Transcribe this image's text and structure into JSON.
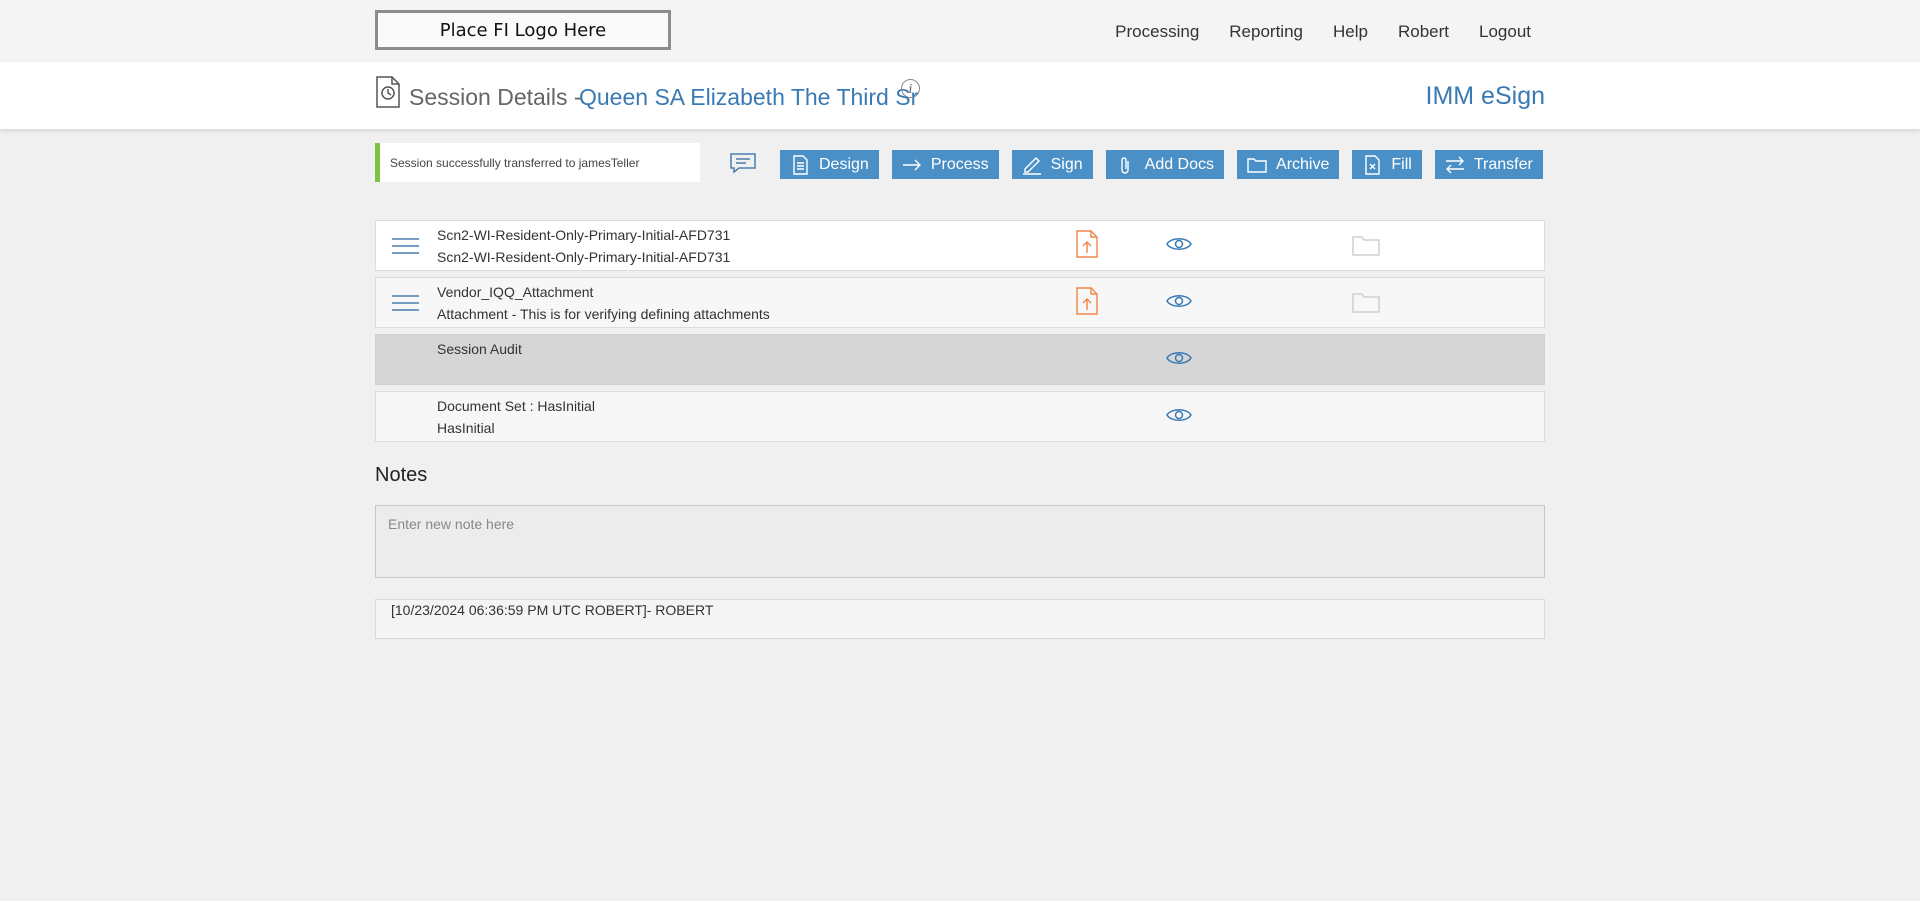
{
  "topbar": {
    "logo_text": "Place FI Logo Here",
    "nav": [
      "Processing",
      "Reporting",
      "Help",
      "Robert",
      "Logout"
    ]
  },
  "header": {
    "label": "Session Details -",
    "session_name": "Queen SA Elizabeth The Third Sr",
    "info_glyph": "i",
    "brand": "IMM eSign"
  },
  "toast": {
    "message": "Session successfully transferred to jamesTeller"
  },
  "actions": [
    {
      "label": "Design",
      "icon": "design-icon"
    },
    {
      "label": "Process",
      "icon": "arrow-right-icon"
    },
    {
      "label": "Sign",
      "icon": "pen-icon"
    },
    {
      "label": "Add Docs",
      "icon": "paperclip-icon"
    },
    {
      "label": "Archive",
      "icon": "folder-icon"
    },
    {
      "label": "Fill",
      "icon": "fill-doc-icon"
    },
    {
      "label": "Transfer",
      "icon": "swap-icon"
    }
  ],
  "documents": [
    {
      "line1": "Scn2-WI-Resident-Only-Primary-Initial-AFD731",
      "line2": "Scn2-WI-Resident-Only-Primary-Initial-AFD731",
      "menu": true,
      "upload": true,
      "folder": true,
      "state": "normal"
    },
    {
      "line1": "Vendor_IQQ_Attachment",
      "line2": "Attachment - This is for verifying defining attachments",
      "menu": true,
      "upload": true,
      "folder": true,
      "state": "alt"
    },
    {
      "line1": "Session Audit",
      "line2": "",
      "menu": false,
      "upload": false,
      "folder": false,
      "state": "selected"
    },
    {
      "line1": "Document Set : HasInitial",
      "line2": "HasInitial",
      "menu": false,
      "upload": false,
      "folder": false,
      "state": "alt"
    }
  ],
  "notes": {
    "title": "Notes",
    "placeholder": "Enter new note here",
    "entries": [
      "[10/23/2024 06:36:59 PM UTC ROBERT]- ROBERT"
    ]
  },
  "colors": {
    "accent": "#4a90c6",
    "link": "#3a7ab4",
    "success": "#7dc242",
    "upload": "#f0864a"
  }
}
